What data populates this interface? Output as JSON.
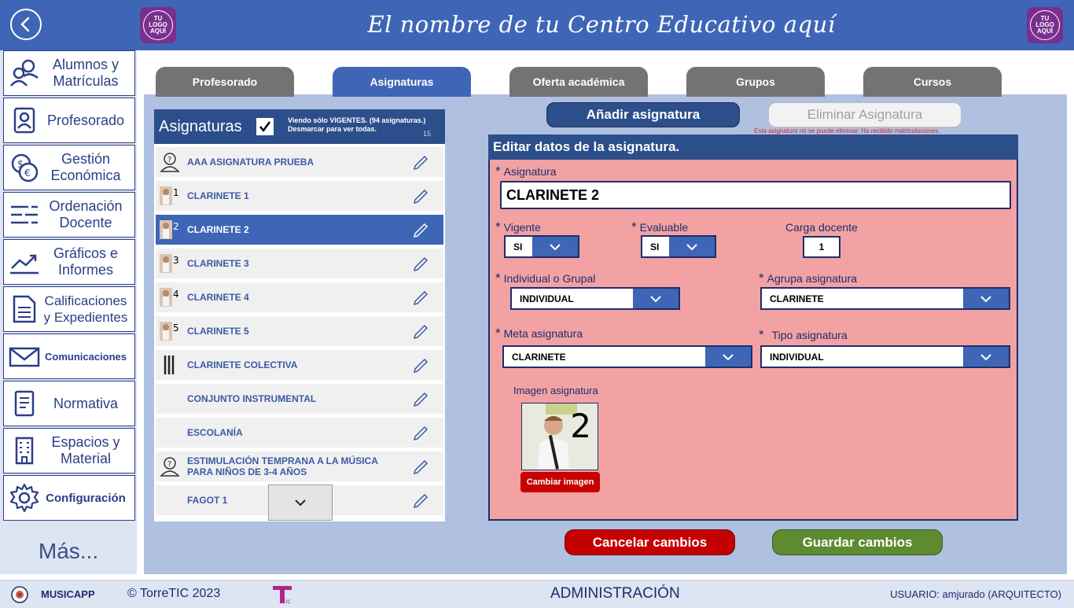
{
  "header": {
    "title": "El nombre de tu Centro Educativo aquí",
    "logo_text": "TU\nLOGO\nAQUÍ"
  },
  "sidebar": {
    "items": [
      {
        "label": "Alumnos y\nMatrículas",
        "icon": "students-icon"
      },
      {
        "label": "Profesorado",
        "icon": "teacher-icon"
      },
      {
        "label": "Gestión\nEconómica",
        "icon": "money-icon"
      },
      {
        "label": "Ordenación\nDocente",
        "icon": "list-icon"
      },
      {
        "label": "Gráficos e\nInformes",
        "icon": "chart-icon"
      },
      {
        "label": "Calificaciones\ny Expedientes",
        "icon": "document-icon"
      },
      {
        "label": "Comunicaciones",
        "icon": "mail-icon"
      },
      {
        "label": "Normativa",
        "icon": "rules-icon"
      },
      {
        "label": "Espacios y\nMaterial",
        "icon": "building-icon"
      },
      {
        "label": "Configuración",
        "icon": "gear-icon"
      }
    ],
    "more": "Más..."
  },
  "tabs": [
    "Profesorado",
    "Asignaturas",
    "Oferta académica",
    "Grupos",
    "Cursos"
  ],
  "list": {
    "title": "Asignaturas",
    "note": "Viendo sólo VIGENTES. (94 asignaturas.)\nDesmarcar para ver todas.",
    "count": "15",
    "rows": [
      {
        "name": "AAA ASIGNATURA PRUEBA",
        "thumb": "placeholder"
      },
      {
        "name": "CLARINETE 1",
        "thumb": "1"
      },
      {
        "name": "CLARINETE 2",
        "thumb": "2"
      },
      {
        "name": "CLARINETE 3",
        "thumb": "3"
      },
      {
        "name": "CLARINETE 4",
        "thumb": "4"
      },
      {
        "name": "CLARINETE 5",
        "thumb": "5"
      },
      {
        "name": "CLARINETE COLECTIVA",
        "thumb": "instrument"
      },
      {
        "name": "CONJUNTO INSTRUMENTAL",
        "thumb": ""
      },
      {
        "name": "ESCOLANÍA",
        "thumb": ""
      },
      {
        "name": "ESTIMULACIÓN TEMPRANA A LA MÚSICA PARA NIÑOS DE 3-4 AÑOS",
        "thumb": "placeholder"
      },
      {
        "name": "FAGOT 1",
        "thumb": ""
      }
    ]
  },
  "actions": {
    "add": "Añadir asignatura",
    "delete": "Eliminar Asignatura",
    "delete_note": "Esta asignatura no se puede eliminar. Ha recibido matriculaciones."
  },
  "form": {
    "title": "Editar datos de la asignatura.",
    "asignatura_label": "Asignatura",
    "asignatura_value": "CLARINETE 2",
    "vigente_label": "Vigente",
    "vigente_value": "SI",
    "evaluable_label": "Evaluable",
    "evaluable_value": "SI",
    "carga_label": "Carga docente",
    "carga_value": "1",
    "indiv_label": "Individual o Grupal",
    "indiv_value": "INDIVIDUAL",
    "agrupa_label": "Agrupa asignatura",
    "agrupa_value": "CLARINETE",
    "meta_label": "Meta asignatura",
    "meta_value": "CLARINETE",
    "tipo_label": "Tipo asignatura",
    "tipo_value": "INDIVIDUAL",
    "imagen_label": "Imagen asignatura",
    "imagen_number": "2",
    "change_image": "Cambiar imagen",
    "star": "*"
  },
  "bottom": {
    "cancel": "Cancelar cambios",
    "save": "Guardar cambios"
  },
  "footer": {
    "app": "MUSICAPP",
    "copyright": "© TorreTIC  2023",
    "section": "ADMINISTRACIÓN",
    "user": "USUARIO: amjurado (ARQUITECTO)"
  },
  "colors": {
    "header": "#3f66b6",
    "dark_blue": "#2c4e8a",
    "form_bg": "#f2a2a2",
    "cancel": "#c40000",
    "save": "#5e8a30"
  }
}
